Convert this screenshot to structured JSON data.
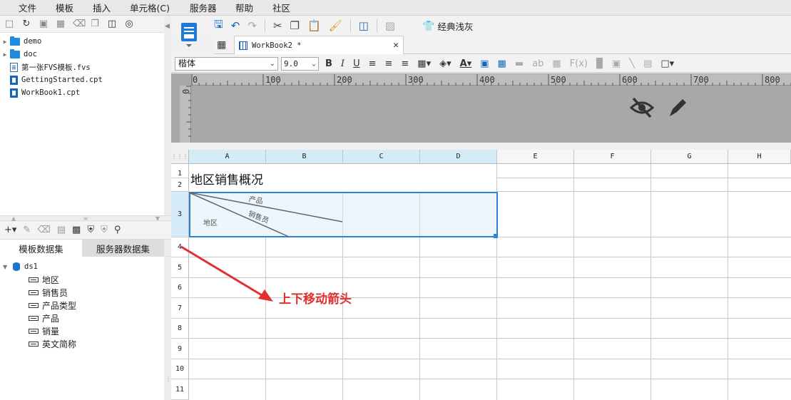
{
  "menu": [
    "文件",
    "模板",
    "插入",
    "单元格(C)",
    "服务器",
    "帮助",
    "社区"
  ],
  "file_tree": [
    {
      "name": "demo",
      "type": "folder"
    },
    {
      "name": "doc",
      "type": "folder"
    },
    {
      "name": "第一张FVS模板.fvs",
      "type": "fvs"
    },
    {
      "name": "GettingStarted.cpt",
      "type": "cpt"
    },
    {
      "name": "WorkBook1.cpt",
      "type": "cpt"
    }
  ],
  "dataset_tabs": [
    "模板数据集",
    "服务器数据集"
  ],
  "dataset": {
    "name": "ds1",
    "fields": [
      "地区",
      "销售员",
      "产品类型",
      "产品",
      "销量",
      "英文简称"
    ]
  },
  "toolbar": {
    "theme_label": "经典浅灰"
  },
  "tab": {
    "label": "WorkBook2 *"
  },
  "format": {
    "font": "楷体",
    "size": "9.0"
  },
  "ruler": {
    "h_labels": [
      "0",
      "100",
      "200",
      "300",
      "400",
      "500",
      "600",
      "700",
      "800"
    ],
    "v_label": "0"
  },
  "sheet": {
    "columns": [
      "A",
      "B",
      "C",
      "D",
      "E",
      "F",
      "G",
      "H"
    ],
    "rows": [
      "1",
      "2",
      "3",
      "4",
      "5",
      "6",
      "7",
      "8",
      "9",
      "10",
      "11"
    ],
    "title": "地区销售概况",
    "diag_labels": {
      "top": "产品",
      "mid": "销售员",
      "bottom": "地区"
    }
  },
  "annotation": "上下移动箭头",
  "colors": {
    "accent": "#2b84d6",
    "annotation": "#e03030",
    "selected_header": "#d6ebf8"
  }
}
